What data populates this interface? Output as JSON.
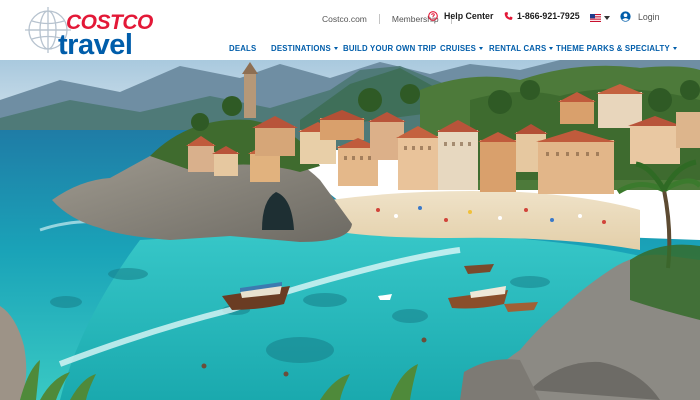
{
  "brand": {
    "name_top": "COSTCO",
    "name_bottom": "travel",
    "primary_color": "#005daa",
    "accent_color": "#e31837"
  },
  "utility_links": [
    "Costco.com",
    "Membership"
  ],
  "help": {
    "label": "Help Center",
    "icon": "question-circle-icon"
  },
  "phone": {
    "number": "1-866-921-7925",
    "icon": "phone-icon"
  },
  "locale": {
    "icon": "us-flag-icon"
  },
  "login": {
    "label": "Login",
    "icon": "user-circle-icon"
  },
  "nav": [
    {
      "label": "DEALS"
    },
    {
      "label": "DESTINATIONS"
    },
    {
      "label": "BUILD YOUR OWN TRIP"
    },
    {
      "label": "CRUISES"
    },
    {
      "label": "RENTAL CARS"
    },
    {
      "label": "THEME PARKS & SPECIALTY"
    }
  ],
  "hero": {
    "icon": "hero-coastal-village-image"
  }
}
